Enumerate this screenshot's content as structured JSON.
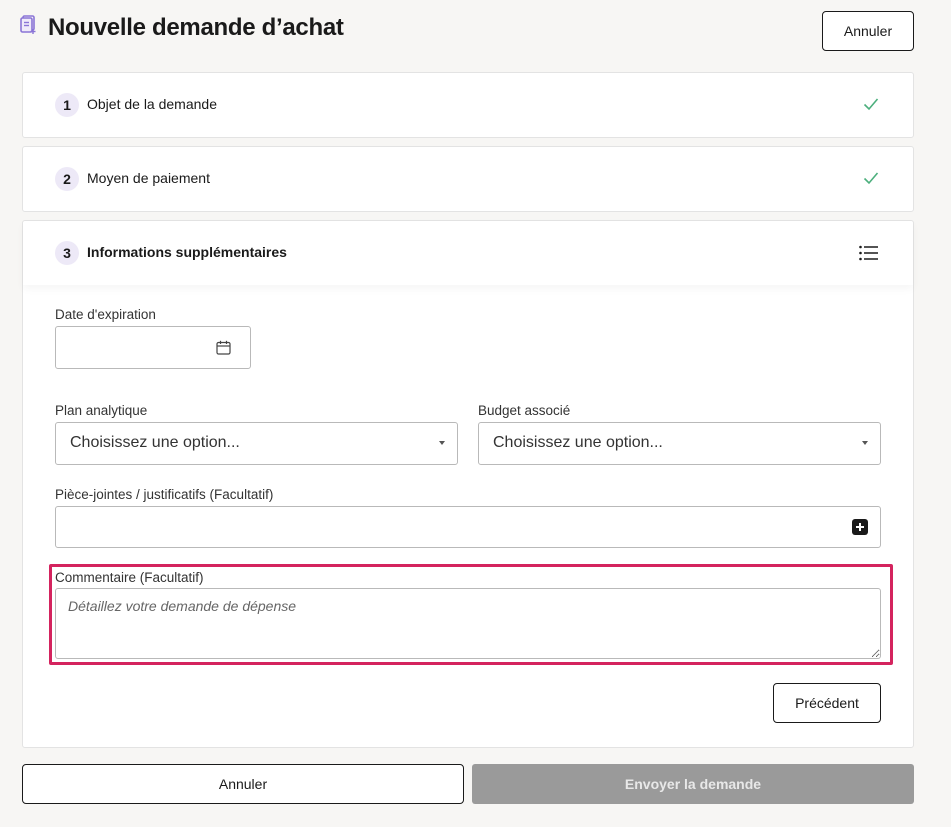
{
  "header": {
    "title": "Nouvelle demande d’achat",
    "cancel_label": "Annuler"
  },
  "steps": [
    {
      "number": "1",
      "label": "Objet de la demande",
      "status_icon": "check-icon"
    },
    {
      "number": "2",
      "label": "Moyen de paiement",
      "status_icon": "check-icon"
    },
    {
      "number": "3",
      "label": "Informations supplémentaires",
      "status_icon": "list-icon"
    }
  ],
  "form": {
    "expiration_label": "Date d'expiration",
    "expiration_value": "",
    "analytic_plan_label": "Plan analytique",
    "analytic_plan_value": "Choisissez une option...",
    "budget_label": "Budget associé",
    "budget_value": "Choisissez une option...",
    "attachments_label": "Pièce-jointes / justificatifs (Facultatif)",
    "comment_label": "Commentaire (Facultatif)",
    "comment_placeholder": "Détaillez votre demande de dépense",
    "previous_label": "Précédent"
  },
  "footer": {
    "cancel_label": "Annuler",
    "submit_label": "Envoyer la demande"
  },
  "colors": {
    "accent_highlight": "#d4235e",
    "check_green": "#4caf7d",
    "step_badge": "#ede9f7",
    "title_icon": "#8a74d6",
    "submit_disabled": "#9a9a9a"
  }
}
